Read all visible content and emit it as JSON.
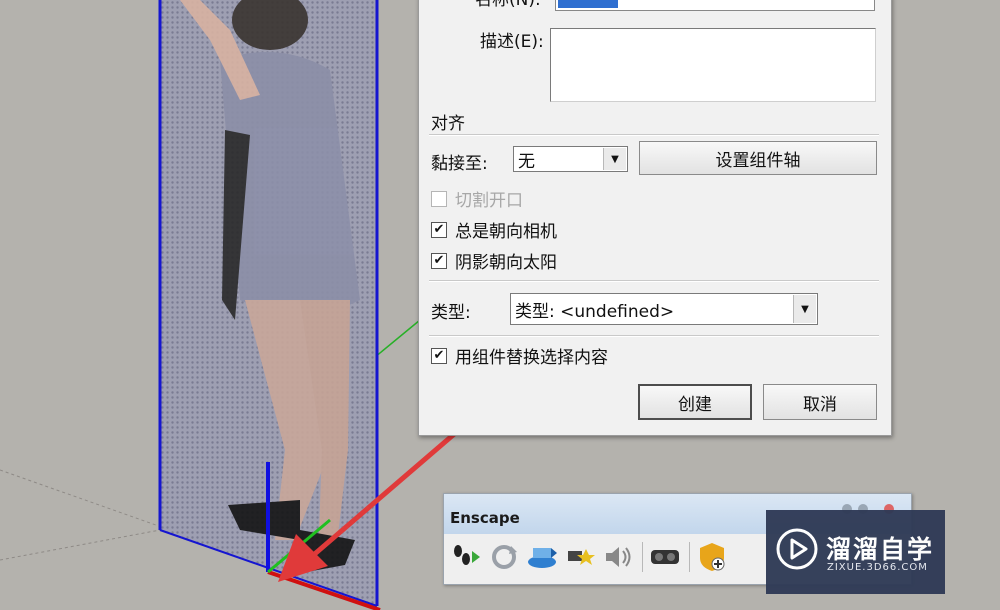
{
  "dialog": {
    "name_label": "名称(N):",
    "description_label": "描述(E):",
    "align_section": "对齐",
    "glue_label": "黏接至:",
    "glue_value": "无",
    "set_axes_button": "设置组件轴",
    "cut_opening": {
      "label": "切割开口",
      "checked": false,
      "enabled": false
    },
    "always_face_camera": {
      "label": "总是朝向相机",
      "checked": true
    },
    "shadows_face_sun": {
      "label": "阴影朝向太阳",
      "checked": true
    },
    "type_label": "类型:",
    "type_value": "类型: <undefined>",
    "replace_selection": {
      "label": "用组件替换选择内容",
      "checked": true
    },
    "create_button": "创建",
    "cancel_button": "取消"
  },
  "enscape_toolbar": {
    "title": "Enscape",
    "icons": [
      "walk-mode-icon",
      "sync-update-icon",
      "live-update-icon",
      "capture-position-icon",
      "sound-icon",
      "vr-headset-icon",
      "asset-library-icon"
    ]
  },
  "watermark": {
    "title": "溜溜自学",
    "subtitle": "ZIXUE.3D66.COM"
  },
  "colors": {
    "dialog_bg": "#f1f1f1",
    "arrow_red": "#e03a3a",
    "axis_blue": "#1515d0",
    "axis_red": "#d01010",
    "watermark_bg": "#2f3a56"
  }
}
